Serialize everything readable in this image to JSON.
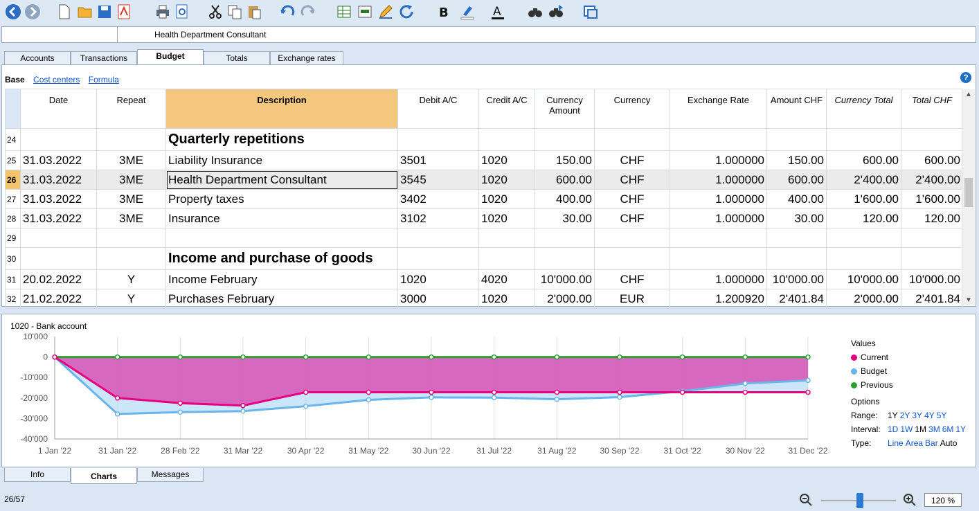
{
  "formula": {
    "cell_ref": "",
    "text": "Health Department Consultant"
  },
  "tabs": [
    "Accounts",
    "Transactions",
    "Budget",
    "Totals",
    "Exchange rates"
  ],
  "active_tab": "Budget",
  "views": {
    "active": "Base",
    "links": [
      "Cost centers",
      "Formula"
    ]
  },
  "columns": [
    "",
    "Date",
    "Repeat",
    "Description",
    "Debit A/C",
    "Credit A/C",
    "Currency Amount",
    "Currency",
    "Exchange Rate",
    "Amount CHF",
    "Currency Total",
    "Total CHF"
  ],
  "rows": [
    {
      "n": "24",
      "date": "",
      "repeat": "",
      "desc": "Quarterly repetitions",
      "debit": "",
      "credit": "",
      "camount": "",
      "cur": "",
      "rate": "",
      "chf": "",
      "ctotal": "",
      "tchf": "",
      "heading": true
    },
    {
      "n": "25",
      "date": "31.03.2022",
      "repeat": "3ME",
      "desc": "Liability Insurance",
      "debit": "3501",
      "credit": "1020",
      "camount": "150.00",
      "cur": "CHF",
      "rate": "1.000000",
      "chf": "150.00",
      "ctotal": "600.00",
      "tchf": "600.00"
    },
    {
      "n": "26",
      "date": "31.03.2022",
      "repeat": "3ME",
      "desc": "Health Department Consultant",
      "debit": "3545",
      "credit": "1020",
      "camount": "600.00",
      "cur": "CHF",
      "rate": "1.000000",
      "chf": "600.00",
      "ctotal": "2'400.00",
      "tchf": "2'400.00",
      "selected": true
    },
    {
      "n": "27",
      "date": "31.03.2022",
      "repeat": "3ME",
      "desc": "Property taxes",
      "debit": "3402",
      "credit": "1020",
      "camount": "400.00",
      "cur": "CHF",
      "rate": "1.000000",
      "chf": "400.00",
      "ctotal": "1'600.00",
      "tchf": "1'600.00"
    },
    {
      "n": "28",
      "date": "31.03.2022",
      "repeat": "3ME",
      "desc": "Insurance",
      "debit": "3102",
      "credit": "1020",
      "camount": "30.00",
      "cur": "CHF",
      "rate": "1.000000",
      "chf": "30.00",
      "ctotal": "120.00",
      "tchf": "120.00"
    },
    {
      "n": "29",
      "date": "",
      "repeat": "",
      "desc": "",
      "debit": "",
      "credit": "",
      "camount": "",
      "cur": "",
      "rate": "",
      "chf": "",
      "ctotal": "",
      "tchf": ""
    },
    {
      "n": "30",
      "date": "",
      "repeat": "",
      "desc": "Income and purchase of goods",
      "debit": "",
      "credit": "",
      "camount": "",
      "cur": "",
      "rate": "",
      "chf": "",
      "ctotal": "",
      "tchf": "",
      "heading": true
    },
    {
      "n": "31",
      "date": "20.02.2022",
      "repeat": "Y",
      "desc": "Income February",
      "debit": "1020",
      "credit": "4020",
      "camount": "10'000.00",
      "cur": "CHF",
      "rate": "1.000000",
      "chf": "10'000.00",
      "ctotal": "10'000.00",
      "tchf": "10'000.00"
    },
    {
      "n": "32",
      "date": "21.02.2022",
      "repeat": "Y",
      "desc": "Purchases February",
      "debit": "3000",
      "credit": "1020",
      "camount": "2'000.00",
      "cur": "EUR",
      "rate": "1.200920",
      "chf": "2'401.84",
      "ctotal": "2'000.00",
      "tchf": "2'401.84"
    }
  ],
  "chart_data": {
    "type": "line",
    "title": "1020 - Bank account",
    "categories": [
      "1 Jan '22",
      "31 Jan '22",
      "28 Feb '22",
      "31 Mar '22",
      "30 Apr '22",
      "31 May '22",
      "30 Jun '22",
      "31 Jul '22",
      "31 Aug '22",
      "30 Sep '22",
      "31 Oct '22",
      "30 Nov '22",
      "31 Dec '22"
    ],
    "yticks": [
      "10'000",
      "0",
      "-10'000",
      "-20'000",
      "-30'000",
      "-40'000"
    ],
    "ylim": [
      -40000,
      10000
    ],
    "series": [
      {
        "name": "Current",
        "color": "#e6007e",
        "values": [
          0,
          -20000,
          -22500,
          -23700,
          -17200,
          -17200,
          -17200,
          -17200,
          -17200,
          -17200,
          -17200,
          -17200,
          -17200
        ]
      },
      {
        "name": "Budget",
        "color": "#6ab4ec",
        "values": [
          0,
          -27800,
          -26900,
          -26400,
          -24000,
          -20900,
          -19700,
          -19800,
          -20600,
          -19600,
          -16700,
          -12900,
          -11400
        ]
      },
      {
        "name": "Previous",
        "color": "#2ca02c",
        "values": [
          0,
          0,
          0,
          0,
          0,
          0,
          0,
          0,
          0,
          0,
          0,
          0,
          0
        ]
      }
    ],
    "legend_title": "Values",
    "options_title": "Options",
    "options": [
      {
        "label": "Range:",
        "items": [
          "1Y",
          "2Y",
          "3Y",
          "4Y",
          "5Y"
        ],
        "active": "1Y"
      },
      {
        "label": "Interval:",
        "items": [
          "1D",
          "1W",
          "1M",
          "3M",
          "6M",
          "1Y"
        ],
        "active": "1M"
      },
      {
        "label": "Type:",
        "items": [
          "Line",
          "Area",
          "Bar",
          "Auto"
        ],
        "active": "Auto"
      }
    ]
  },
  "bottom_tabs": [
    "Info",
    "Charts",
    "Messages"
  ],
  "active_bottom_tab": "Charts",
  "status": {
    "position": "26/57",
    "zoom": "120 %"
  }
}
